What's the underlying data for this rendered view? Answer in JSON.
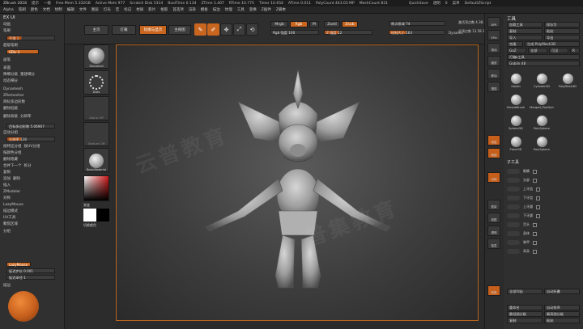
{
  "titlebar": {
    "app": "ZBrush 2018",
    "items": [
      "提示",
      "一级",
      "Free Mem 5.332GB",
      "Active Mem 977",
      "Scratch Disk 5314",
      "BoolTime 0.134",
      "ZTime 1.407",
      "RTime 10.775",
      "Timer 10.654",
      "ATime 0.011",
      "PolyCount 443.03 MP",
      "MeshCount 831"
    ],
    "quicksave": "QuickSave",
    "alpha_label": "透明",
    "alpha_value": "0",
    "menus_label": "菜单",
    "script": "DefaultZScript"
  },
  "menubar": {
    "items": [
      "Alpha",
      "笔刷",
      "颜色",
      "文档",
      "绘制",
      "编辑",
      "文件",
      "图层",
      "灯光",
      "宏",
      "标记",
      "材质",
      "影片",
      "拾取",
      "首选项",
      "渲染",
      "模板",
      "描边",
      "纹理",
      "工具",
      "变换",
      "Z插件",
      "Z脚本"
    ]
  },
  "leftpanel": {
    "title": "EX UI",
    "rows": [
      "动画",
      "笔刷",
      "超级笔刷",
      "画笔",
      "表面",
      "降细分级",
      "重建细分",
      "动态细分",
      "Dynamesh",
      "ZRemesher",
      "目标多边形数",
      "删除低级",
      "删除高级",
      "分辨率",
      "自动分组",
      "分组",
      "按特征分组",
      "按UV分组",
      "按颜色分组",
      "删除隐藏",
      "合并下一个",
      "拆分",
      "复制",
      "追加",
      "删除",
      "插入",
      "ZModeler",
      "对称",
      "LazyMouse",
      "描边模式",
      "UV工具",
      "聚焦区域"
    ],
    "sliders": {
      "smooth": "平滑 1",
      "sub_div": "SDiv 2",
      "res": "分辨率 128",
      "target": "目标多边形数 5.06967",
      "lazy_step": "延迟步长 0.001",
      "lazy_radius": "延迟半径 1"
    },
    "lazymouse": "LazyMouse",
    "stroke_label": "描边"
  },
  "shelf": {
    "tabs": [
      "主页",
      "灯箱",
      "轮廓与显示",
      "主视图"
    ],
    "draw_buttons": [
      "编辑",
      "绘制",
      "移动",
      "缩放",
      "旋转"
    ],
    "mrgb": "Mrgb",
    "rgb": "Rgb",
    "m": "M",
    "zadd": "Zadd",
    "zsub": "Zsub",
    "rgb_intensity": "Rgb 强度 100",
    "z_intensity": "Z 强度 12",
    "focal_shift": "焦点衰减 74",
    "draw_size": "绘制大小 163",
    "dynamic": "Dynamic",
    "active_points": "激活顶点数 4.38.5",
    "total_points": "总顶点数 13.58.1"
  },
  "toolstrip": {
    "items": [
      "Standard",
      "Dots",
      "Alpha Off",
      "Texture Off",
      "BasicMaterial"
    ],
    "color_label": "颜色",
    "switch_color": "切换颜色",
    "gradient": "渐变"
  },
  "rightstrip": {
    "icons": [
      "BPR",
      "SPix",
      "滚动",
      "缩放",
      "移动",
      "透视",
      "地板",
      "局部",
      "对称",
      "框架",
      "线框",
      "透明",
      "独显",
      "转换"
    ]
  },
  "toolpanel": {
    "header": "工具",
    "buttons": [
      "加载工具",
      "保存为",
      "复制",
      "粘贴",
      "导入",
      "导出",
      "克隆",
      "生成 PolyMesh3D",
      "GoZ",
      "全部",
      "可见",
      "R"
    ],
    "current_tool_label": "灯箱▸工具",
    "current_tool_value": "Goblin 48",
    "thumbs": [
      "Goblin",
      "Cylinder3D",
      "PolyMesh3D",
      "SimpleBrush",
      "Merged_PolySph",
      "Sphere3D",
      "PolySphere",
      "Plane3D",
      "PolySphere"
    ],
    "subtool_label": "子工具",
    "brush_names": [
      "眼睛",
      "头部",
      "上牙齿",
      "下牙齿",
      "上牙龈",
      "下牙龈",
      "舌头",
      "身体",
      "装甲",
      "耳朵"
    ],
    "list_all": "全部列出",
    "auto_collapse": "自动折叠",
    "rename": "重命名",
    "auto_reorder": "自动排序",
    "all_low": "最低细分级",
    "all_high": "最高细分级",
    "copy": "复制",
    "paste": "粘贴"
  },
  "watermark": [
    "云普教育",
    "普集教育"
  ],
  "colors": {
    "accent": "#c8651f",
    "panel": "#303030",
    "viewport_border": "#b8651d"
  }
}
